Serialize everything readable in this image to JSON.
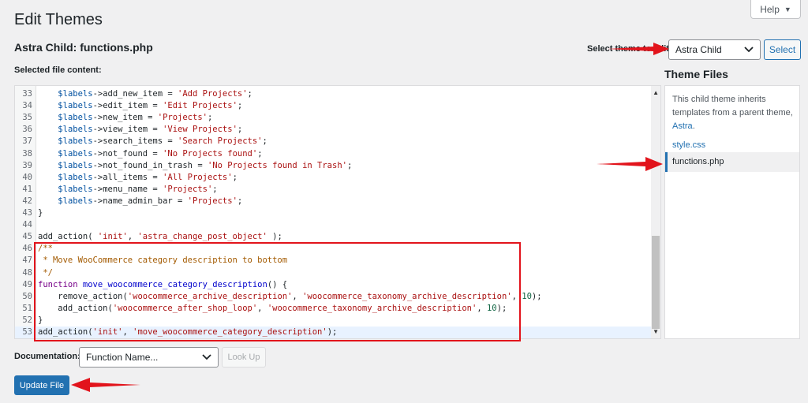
{
  "header": {
    "page_title": "Edit Themes",
    "help_label": "Help",
    "file_title": "Astra Child: functions.php",
    "selected_file_label": "Selected file content:"
  },
  "theme_picker": {
    "label": "Select theme to edit:",
    "selected": "Astra Child",
    "button_label": "Select"
  },
  "editor": {
    "lines": [
      {
        "n": "33",
        "text": "    $labels->add_new_item = 'Add Projects';"
      },
      {
        "n": "34",
        "text": "    $labels->edit_item = 'Edit Projects';"
      },
      {
        "n": "35",
        "text": "    $labels->new_item = 'Projects';"
      },
      {
        "n": "36",
        "text": "    $labels->view_item = 'View Projects';"
      },
      {
        "n": "37",
        "text": "    $labels->search_items = 'Search Projects';"
      },
      {
        "n": "38",
        "text": "    $labels->not_found = 'No Projects found';"
      },
      {
        "n": "39",
        "text": "    $labels->not_found_in_trash = 'No Projects found in Trash';"
      },
      {
        "n": "40",
        "text": "    $labels->all_items = 'All Projects';"
      },
      {
        "n": "41",
        "text": "    $labels->menu_name = 'Projects';"
      },
      {
        "n": "42",
        "text": "    $labels->name_admin_bar = 'Projects';"
      },
      {
        "n": "43",
        "text": "}"
      },
      {
        "n": "44",
        "text": ""
      },
      {
        "n": "45",
        "text": "add_action( 'init', 'astra_change_post_object' );"
      },
      {
        "n": "46",
        "text": "/**"
      },
      {
        "n": "47",
        "text": " * Move WooCommerce category description to bottom"
      },
      {
        "n": "48",
        "text": " */"
      },
      {
        "n": "49",
        "text": "function move_woocommerce_category_description() {"
      },
      {
        "n": "50",
        "text": "    remove_action('woocommerce_archive_description', 'woocommerce_taxonomy_archive_description', 10);"
      },
      {
        "n": "51",
        "text": "    add_action('woocommerce_after_shop_loop', 'woocommerce_taxonomy_archive_description', 10);"
      },
      {
        "n": "52",
        "text": "}"
      },
      {
        "n": "53",
        "text": "add_action('init', 'move_woocommerce_category_description');"
      }
    ]
  },
  "sidebar": {
    "title": "Theme Files",
    "note_prefix": "This child theme inherits templates from a parent theme,",
    "note_link": "Astra",
    "note_suffix": ".",
    "files": [
      {
        "name": "style.css"
      },
      {
        "name": "functions.php"
      }
    ]
  },
  "footer": {
    "doc_label": "Documentation:",
    "doc_placeholder": "Function Name...",
    "lookup_label": "Look Up",
    "update_label": "Update File"
  },
  "colors": {
    "accent": "#2271b1",
    "annotation_red": "#e2141c"
  }
}
